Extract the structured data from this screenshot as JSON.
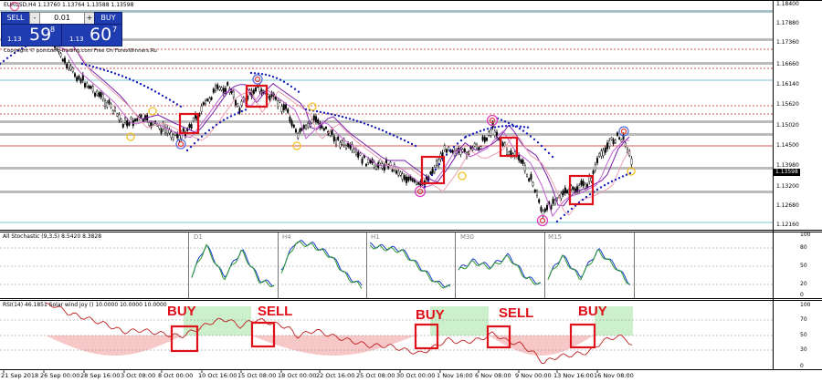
{
  "header": {
    "symbol_info": "EURUSD,H4  1.13760 1.13764 1.13588 1.13598",
    "copyright": "Copyright © pointzero-trading.com Free On ForexWinners.Ru"
  },
  "trade_panel": {
    "sell_label": "SELL",
    "buy_label": "BUY",
    "lot_minus": "-",
    "lot_value": "0.01",
    "lot_plus": "+",
    "sell_price_prefix": "1.13",
    "sell_price_big": "59",
    "sell_price_sup": "8",
    "buy_price_prefix": "1.13",
    "buy_price_big": "60",
    "buy_price_sup": "7"
  },
  "price_axis": {
    "labels": [
      "1.18400",
      "1.17880",
      "1.17360",
      "1.16660",
      "1.16140",
      "1.15620",
      "1.15020",
      "1.14500",
      "1.13980",
      "1.13200",
      "1.12680",
      "1.12160"
    ],
    "current_price": "1.13598"
  },
  "stochastic": {
    "label": "All Stochastic (9,3,5) 8.5420 8.3828",
    "timeframes": [
      "D1",
      "H4",
      "H1",
      "M30",
      "M15"
    ],
    "axis_labels": [
      "100",
      "80",
      "50",
      "20",
      "0"
    ]
  },
  "rsi": {
    "label": "RSI(14) 46.1851  Solar wind joy () 10.0000 10.0000 10.0000",
    "axis_labels": [
      "100",
      "70",
      "50",
      "30",
      "0"
    ]
  },
  "signals": [
    "BUY",
    "SELL",
    "BUY",
    "SELL",
    "BUY"
  ],
  "time_axis": [
    "21 Sep 2018",
    "26 Sep 00:00",
    "28 Sep 16:00",
    "3 Oct 08:00",
    "8 Oct 00:00",
    "10 Oct 16:00",
    "15 Oct 08:00",
    "18 Oct 00:00",
    "22 Oct 16:00",
    "25 Oct 08:00",
    "30 Oct 00:00",
    "1 Nov 16:00",
    "6 Nov 08:00",
    "9 Nov 00:00",
    "13 Nov 16:00",
    "16 Nov 08:00"
  ],
  "colors": {
    "signal_box": "#e0101a",
    "band_dots": "#1a23b8",
    "ma_purple": "#7a1ea8",
    "rsi_green": "#6ed36e",
    "rsi_red": "#e86060",
    "trade_panel": "#1f3db0"
  }
}
